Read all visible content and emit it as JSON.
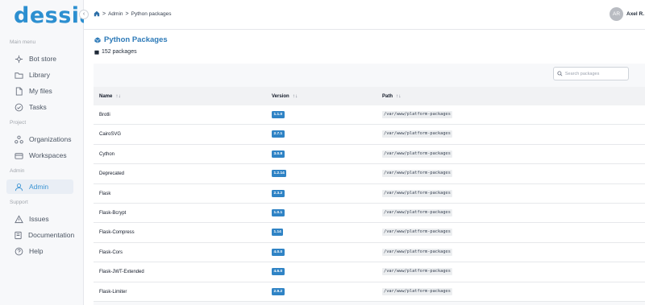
{
  "app": {
    "logo": "dessia",
    "collapse_glyph": "‹"
  },
  "sidebar": {
    "sections": [
      {
        "label": "Main menu"
      },
      {
        "label": "Project"
      },
      {
        "label": "Admin"
      },
      {
        "label": "Support"
      }
    ],
    "items": [
      {
        "label": "Bot store",
        "icon": "bot-store-icon"
      },
      {
        "label": "Library",
        "icon": "folder-icon"
      },
      {
        "label": "My files",
        "icon": "file-icon"
      },
      {
        "label": "Tasks",
        "icon": "check-circle-icon"
      },
      {
        "label": "Organizations",
        "icon": "organizations-icon"
      },
      {
        "label": "Workspaces",
        "icon": "workspaces-icon"
      },
      {
        "label": "Admin",
        "icon": "admin-icon",
        "active": true
      },
      {
        "label": "Issues",
        "icon": "warning-icon"
      },
      {
        "label": "Documentation",
        "icon": "book-icon"
      },
      {
        "label": "Help",
        "icon": "help-icon"
      }
    ]
  },
  "header": {
    "breadcrumb": {
      "home_icon": "home-icon",
      "separator": ">",
      "items": [
        "Admin",
        "Python packages"
      ]
    },
    "user": {
      "initials": "AR",
      "name": "Axel R."
    }
  },
  "page": {
    "title": "Python Packages",
    "count_text": "152 packages",
    "search": {
      "placeholder": "Search packages",
      "value": ""
    }
  },
  "table": {
    "columns": [
      {
        "label": "Name",
        "sort_glyph": "↑↓"
      },
      {
        "label": "Version",
        "sort_glyph": "↑↓"
      },
      {
        "label": "Path",
        "sort_glyph": "↑↓"
      }
    ],
    "rows": [
      {
        "name": "Brotli",
        "version": "1.1.0",
        "path": "/var/www/platform-packages"
      },
      {
        "name": "CairoSVG",
        "version": "2.7.1",
        "path": "/var/www/platform-packages"
      },
      {
        "name": "Cython",
        "version": "3.0.8",
        "path": "/var/www/platform-packages"
      },
      {
        "name": "Deprecated",
        "version": "1.2.14",
        "path": "/var/www/platform-packages"
      },
      {
        "name": "Flask",
        "version": "2.3.2",
        "path": "/var/www/platform-packages"
      },
      {
        "name": "Flask-Bcrypt",
        "version": "1.0.1",
        "path": "/var/www/platform-packages"
      },
      {
        "name": "Flask-Compress",
        "version": "1.14",
        "path": "/var/www/platform-packages"
      },
      {
        "name": "Flask-Cors",
        "version": "4.0.0",
        "path": "/var/www/platform-packages"
      },
      {
        "name": "Flask-JWT-Extended",
        "version": "4.6.0",
        "path": "/var/www/platform-packages"
      },
      {
        "name": "Flask-Limiter",
        "version": "2.9.2",
        "path": "/var/www/platform-packages"
      }
    ]
  },
  "colors": {
    "brand": "#2c8fd0",
    "badge": "#2f83c5",
    "active_nav": "#3b94d3"
  }
}
